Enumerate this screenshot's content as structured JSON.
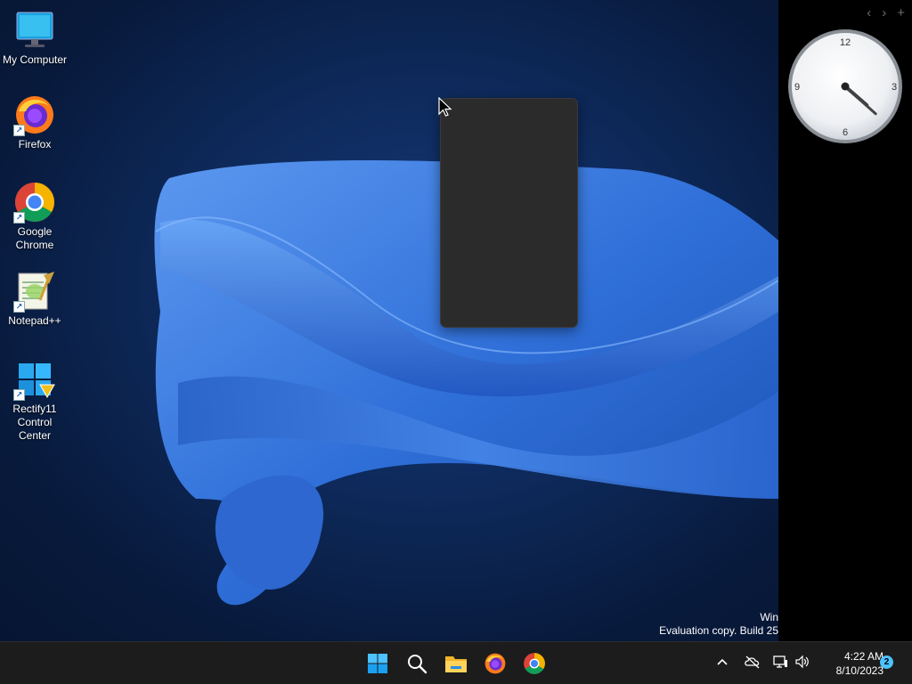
{
  "desktop": {
    "icons": [
      {
        "label": "My Computer",
        "icon": "monitor-icon"
      },
      {
        "label": "Firefox",
        "icon": "firefox-icon"
      },
      {
        "label": "Google Chrome",
        "icon": "chrome-icon"
      },
      {
        "label": "Notepad++",
        "icon": "notepadpp-icon"
      },
      {
        "label": "Rectify11 Control Center",
        "icon": "rectify11-icon"
      }
    ],
    "watermark": {
      "line1": "Win",
      "line2": "Evaluation copy. Build 25"
    }
  },
  "sidebar": {
    "controls": {
      "prev": "‹",
      "next": "›",
      "add": "+"
    },
    "clock": {
      "numerals": {
        "twelve": "12",
        "three": "3",
        "six": "6",
        "nine": "9"
      },
      "time": "4:22"
    }
  },
  "taskbar": {
    "apps": [
      "start-icon",
      "search-icon",
      "file-explorer-icon",
      "firefox-icon",
      "chrome-icon"
    ],
    "tray": {
      "chevron": "^",
      "icons": [
        "onedrive-offline-icon",
        "network-icon",
        "volume-icon"
      ]
    },
    "time": "4:22 AM",
    "date": "8/10/2023",
    "notification_count": "2"
  },
  "colors": {
    "accent": "#4cc2ff",
    "wallpaper_ribbon": "#3b78e0",
    "taskbar_bg": "#1c1c1c"
  }
}
